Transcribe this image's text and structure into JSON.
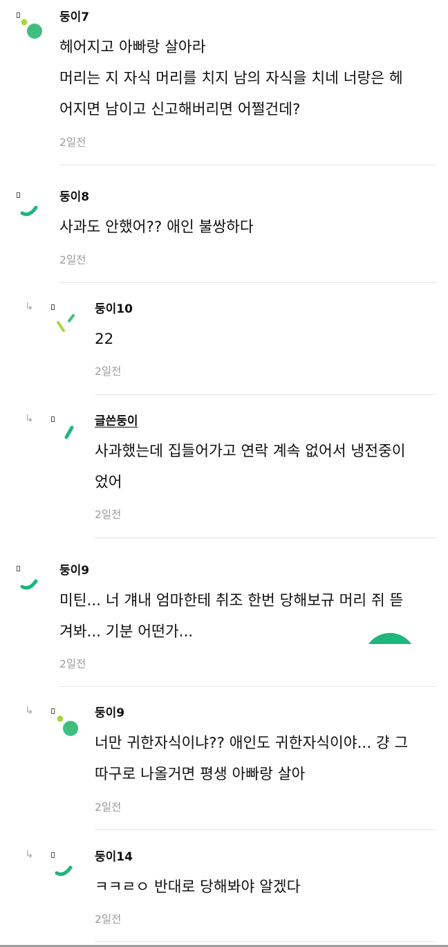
{
  "comments": [
    {
      "author": "둥이7",
      "lines": [
        "헤어지고 아빠랑 살아라",
        "머리는 지 자식 머리를 치지 남의 자식을 치네 너랑은 헤",
        "어지면 남이고 신고해버리면 어쩔건데?"
      ],
      "time": "2일전",
      "avatar_icon": "dots-avatar-icon"
    },
    {
      "author": "둥이8",
      "lines": [
        "사과도 안했어?? 애인 불쌍하다"
      ],
      "time": "2일전",
      "avatar_icon": "smile-arc-avatar-icon"
    },
    {
      "author": "둥이10",
      "lines": [
        "22"
      ],
      "time": "2일전",
      "avatar_icon": "dashes-avatar-icon",
      "reply_icon": "↳"
    },
    {
      "author": "글쓴둥이",
      "lines": [
        "사과했는데 집들어가고 연락 계속 없어서 냉전중이",
        "었어"
      ],
      "time": "2일전",
      "avatar_icon": "slash-avatar-icon",
      "reply_icon": "↳"
    },
    {
      "author": "둥이9",
      "lines": [
        "미틴... 너 걔내 엄마한테 취조 한번 당해보규 머리 쥐 뜯",
        "겨봐... 기분 어떤가..."
      ],
      "time": "2일전",
      "avatar_icon": "smile-arc-avatar-icon"
    },
    {
      "author": "둥이9",
      "lines": [
        "너만 귀한자식이냐?? 애인도 귀한자식이야... 걍 그",
        "따구로 나올거면 평생 아빠랑 살아"
      ],
      "time": "2일전",
      "avatar_icon": "dots-avatar-icon",
      "reply_icon": "↳"
    },
    {
      "author": "둥이14",
      "lines": [
        "ㅋㅋㄹㅇ 반대로 당해봐야 알겠다"
      ],
      "time": "2일전",
      "avatar_icon": "smile-arc-avatar-icon",
      "reply_icon": "↳"
    }
  ],
  "colors": {
    "avatar_green": "#3fbf7f",
    "avatar_lime": "#a6d83b",
    "avatar_teal": "#1db67b",
    "time_gray": "#9a9a9a",
    "divider": "#e6e6e6"
  }
}
